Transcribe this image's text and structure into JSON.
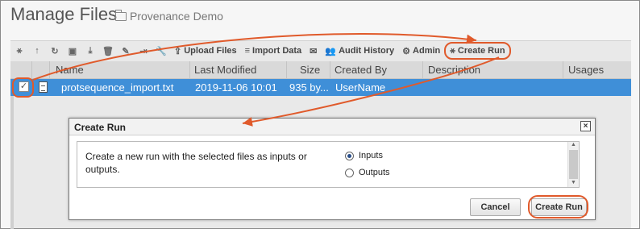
{
  "page": {
    "title": "Manage Files",
    "folder": "Provenance Demo"
  },
  "toolbar": {
    "upload_label": "Upload Files",
    "import_label": "Import Data",
    "audit_label": "Audit History",
    "admin_label": "Admin",
    "create_run_label": "Create Run"
  },
  "grid": {
    "columns": [
      "Name",
      "Last Modified",
      "Size",
      "Created By",
      "Description",
      "Usages"
    ],
    "rows": [
      {
        "selected": true,
        "checked": "✓",
        "name": "protsequence_import.txt",
        "last_modified": "2019-11-06 10:01",
        "size": "935 by...",
        "created_by": "UserName",
        "description": "",
        "usages": ""
      }
    ]
  },
  "dialog": {
    "title": "Create Run",
    "close_glyph": "×",
    "message": "Create a new run with the selected files as inputs or outputs.",
    "options": [
      {
        "label": "Inputs",
        "checked": true
      },
      {
        "label": "Outputs",
        "checked": false
      }
    ],
    "cancel_label": "Cancel",
    "create_label": "Create Run"
  },
  "colors": {
    "selection": "#3f8fd8",
    "highlight": "#e05a2b"
  }
}
